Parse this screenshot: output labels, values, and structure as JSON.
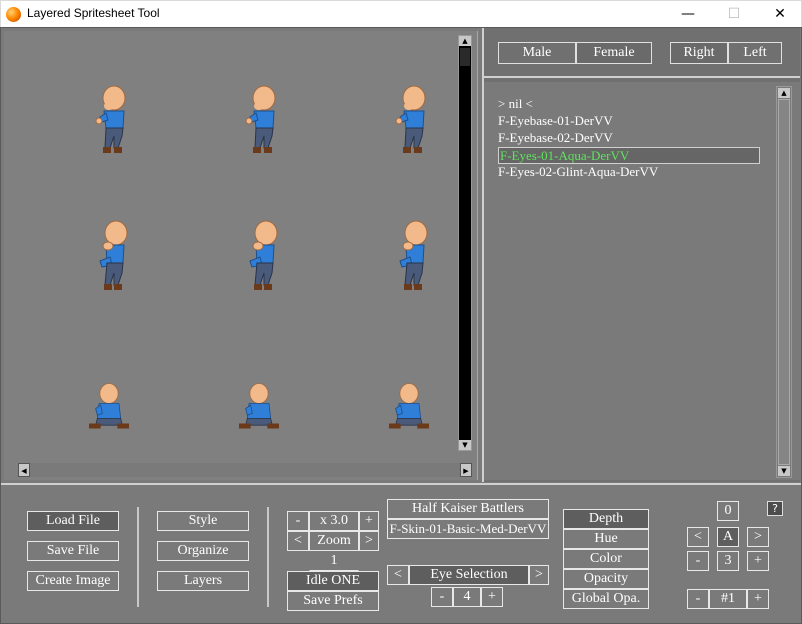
{
  "window": {
    "title": "Layered Spritesheet Tool",
    "min_label": "—",
    "max_label": "☐",
    "close_label": "✕"
  },
  "gender": {
    "male": "Male",
    "female": "Female"
  },
  "facing": {
    "right": "Right",
    "left": "Left"
  },
  "layers": [
    "> nil <",
    "F-Eyebase-01-DerVV",
    "F-Eyebase-02-DerVV",
    "F-Eyes-01-Aqua-DerVV",
    "F-Eyes-02-Glint-Aqua-DerVV"
  ],
  "selected_layer_index": 3,
  "file_buttons": {
    "load": "Load File",
    "save": "Save File",
    "create": "Create Image"
  },
  "view_buttons": {
    "style": "Style",
    "organize": "Organize",
    "layers": "Layers"
  },
  "zoom": {
    "minus": "-",
    "plus": "+",
    "value": "x 3.0",
    "prev": "<",
    "next": ">",
    "label": "Zoom",
    "frame": "1",
    "anim": "Idle ONE",
    "save_prefs": "Save Prefs"
  },
  "sheet": {
    "name": "Half Kaiser Battlers",
    "skin": "F-Skin-01-Basic-Med-DerVV"
  },
  "selection": {
    "prev": "<",
    "next": ">",
    "label": "Eye Selection",
    "minus": "-",
    "plus": "+",
    "count": "4"
  },
  "adjust": {
    "depth": "Depth",
    "hue": "Hue",
    "color": "Color",
    "opacity": "Opacity",
    "global": "Global Opa."
  },
  "right_controls": {
    "top_value": "0",
    "prev": "<",
    "letter": "A",
    "next": ">",
    "minus": "-",
    "num": "3",
    "plus": "+",
    "minus2": "-",
    "slot": "#1",
    "plus2": "+"
  },
  "help_label": "?",
  "colors": {
    "bg": "#7a7a7a",
    "selected_text": "#5fe35f",
    "shirt": "#2f7fd8",
    "skin": "#f2b98a"
  },
  "scroll": {
    "up": "▲",
    "down": "▼",
    "left": "◀",
    "right": "▶"
  }
}
